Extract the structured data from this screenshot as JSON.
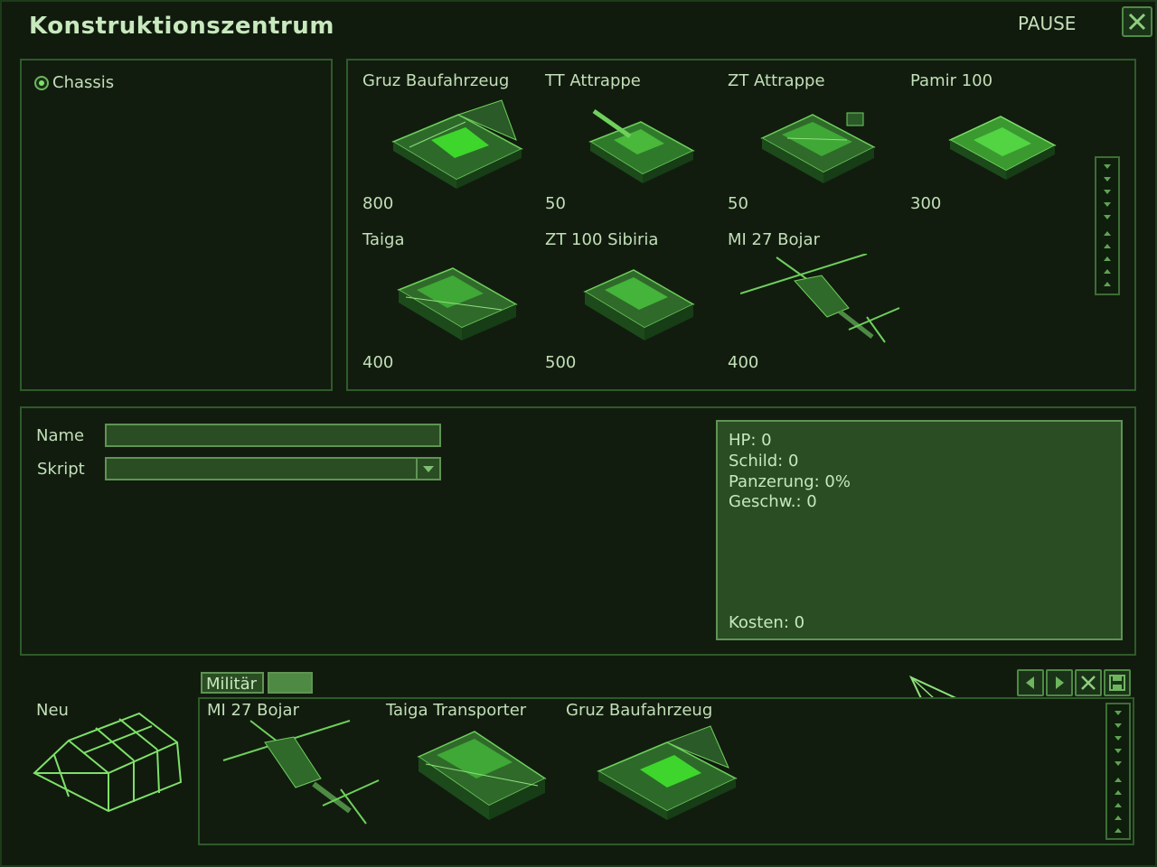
{
  "header": {
    "title": "Konstruktionszentrum",
    "pause_label": "PAUSE"
  },
  "chassis_panel": {
    "category_label": "Chassis"
  },
  "vehicles": [
    {
      "name": "Gruz Baufahrzeug",
      "cost": "800",
      "icon": "construction-vehicle-icon"
    },
    {
      "name": "TT Attrappe",
      "cost": "50",
      "icon": "tank-icon"
    },
    {
      "name": "ZT Attrappe",
      "cost": "50",
      "icon": "heavy-tank-icon"
    },
    {
      "name": "Pamir 100",
      "cost": "300",
      "icon": "light-tank-icon"
    },
    {
      "name": "Taiga",
      "cost": "400",
      "icon": "tracked-vehicle-icon"
    },
    {
      "name": "ZT 100 Sibiria",
      "cost": "500",
      "icon": "tracked-vehicle-icon"
    },
    {
      "name": "MI 27 Bojar",
      "cost": "400",
      "icon": "helicopter-icon"
    }
  ],
  "design": {
    "name_label": "Name",
    "name_value": "",
    "script_label": "Skript",
    "script_value": ""
  },
  "stats": {
    "hp": "HP: 0",
    "shield": "Schild: 0",
    "armor": "Panzerung: 0%",
    "speed": "Geschw.: 0",
    "cost": "Kosten: 0"
  },
  "templates": {
    "new_label": "Neu",
    "tab_label": "Militär",
    "items": [
      {
        "name": "MI 27 Bojar",
        "icon": "helicopter-icon"
      },
      {
        "name": "Taiga Transporter",
        "icon": "tracked-vehicle-icon"
      },
      {
        "name": "Gruz Baufahrzeug",
        "icon": "construction-vehicle-icon"
      }
    ]
  },
  "colors": {
    "background": "#101b0d",
    "panel_border": "#2f5a2a",
    "accent": "#5fe04a",
    "field_fill": "#2a4d24",
    "text": "#c3dfb9"
  }
}
